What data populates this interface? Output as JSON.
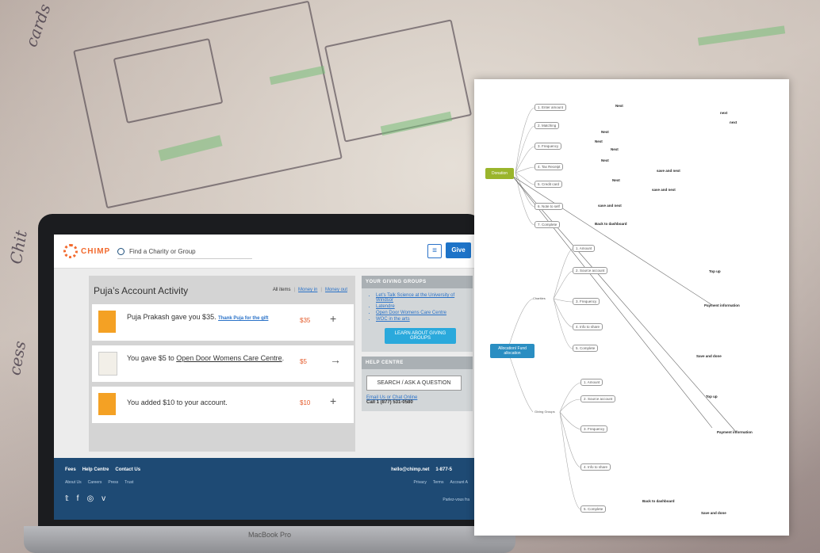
{
  "site": {
    "logo_text": "CHIMP",
    "search_placeholder": "Find a Charity or Group",
    "menu_icon": "≡",
    "give_label": "Give"
  },
  "activity": {
    "title": "Puja’s Account Activity",
    "tabs": [
      "All items",
      "Money in",
      "Money out"
    ],
    "items": [
      {
        "text": "Puja Prakash gave you $35.",
        "link": "Thank Puja for the gift",
        "amount": "$35",
        "action": "+"
      },
      {
        "text_pre": "You gave $5 to ",
        "text_link": "Open Door Womens Care Centre",
        "text_post": ".",
        "amount": "$5",
        "action": "→"
      },
      {
        "text": "You added $10 to your account.",
        "amount": "$10",
        "action": "+"
      }
    ]
  },
  "giving_groups": {
    "header": "YOUR GIVING GROUPS",
    "items": [
      "Let’s Talk Science at the University of Windsor",
      "Latendre",
      "Open Door Womens Care Centre",
      "WOC in the arts"
    ],
    "button": "LEARN ABOUT GIVING GROUPS"
  },
  "help": {
    "header": "HELP CENTRE",
    "button": "SEARCH / ASK A QUESTION",
    "link": "Email Us or Chat Online",
    "phone": "Call 1 (877) 531-0580"
  },
  "footer": {
    "links": [
      "Fees",
      "Help Centre",
      "Contact Us"
    ],
    "sub_links": [
      "About Us",
      "Careers",
      "Press",
      "Trust"
    ],
    "email": "hello@chimp.net",
    "phone": "1-877-5",
    "sub_links_right": [
      "Privacy",
      "Terms",
      "Account A"
    ],
    "language": "Parlez-vous fra",
    "social": [
      "𝕥",
      "f",
      "◎",
      "v"
    ]
  },
  "laptop_label": "MacBook Pro",
  "mindmap": {
    "root": "Donation",
    "root2": "Allocation/ Fund allocation",
    "donation_nodes": [
      "1. Enter amount",
      "2. Matching",
      "3. Frequency",
      "4. Tax Receipt",
      "5. Credit card",
      "6. Note to self",
      "7. Complete"
    ],
    "charities": "Charities",
    "charity_nodes": [
      "1. Amount",
      "2. Source account",
      "3. Frequency",
      "4. Info to share",
      "5. Complete"
    ],
    "giving_groups": "Giving Groups",
    "group_nodes": [
      "1. Amount",
      "2. Source account",
      "3. Frequency",
      "4. Info to share",
      "5. Complete"
    ],
    "labels_bold": [
      "Next",
      "next",
      "save and next",
      "Back to dashboard",
      "Top up",
      "Payment information",
      "Save and done"
    ]
  }
}
